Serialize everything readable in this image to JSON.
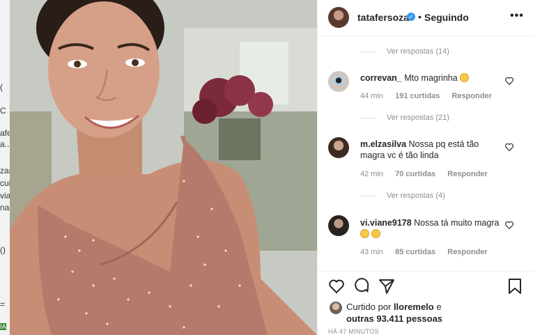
{
  "background_fragments": [
    "(",
    "C",
    "afe",
    "a...",
    "zas",
    "cui",
    "via",
    "nagra",
    "()",
    "=",
    "IA"
  ],
  "post": {
    "username": "tatafersoza",
    "follow_status": "Seguindo",
    "dot": "•",
    "more": "•••"
  },
  "comments": [
    {
      "type": "replies",
      "label": "Ver respostas (14)"
    },
    {
      "type": "comment",
      "user": "correvan_",
      "text": "Mto magrinha",
      "time": "44 min",
      "likes": "191 curtidas",
      "reply": "Responder"
    },
    {
      "type": "replies",
      "label": "Ver respostas (21)"
    },
    {
      "type": "comment",
      "user": "m.elzasilva",
      "text": "Nossa pq está tão magra vc é tão linda",
      "time": "42 min",
      "likes": "70 curtidas",
      "reply": "Responder"
    },
    {
      "type": "replies",
      "label": "Ver respostas (4)"
    },
    {
      "type": "comment",
      "user": "vi.viane9178",
      "text": "Nossa tá muito magra",
      "time": "43 min",
      "likes": "85 curtidas",
      "reply": "Responder"
    }
  ],
  "likes": {
    "prefix": "Curtido por",
    "user": "lloremelo",
    "and": "e",
    "others": "outras 93.411 pessoas"
  },
  "time_ago": "HÁ 47 MINUTOS",
  "colors": {
    "verified": "#3897f0",
    "muted": "#8e8e8e",
    "text": "#262626"
  }
}
